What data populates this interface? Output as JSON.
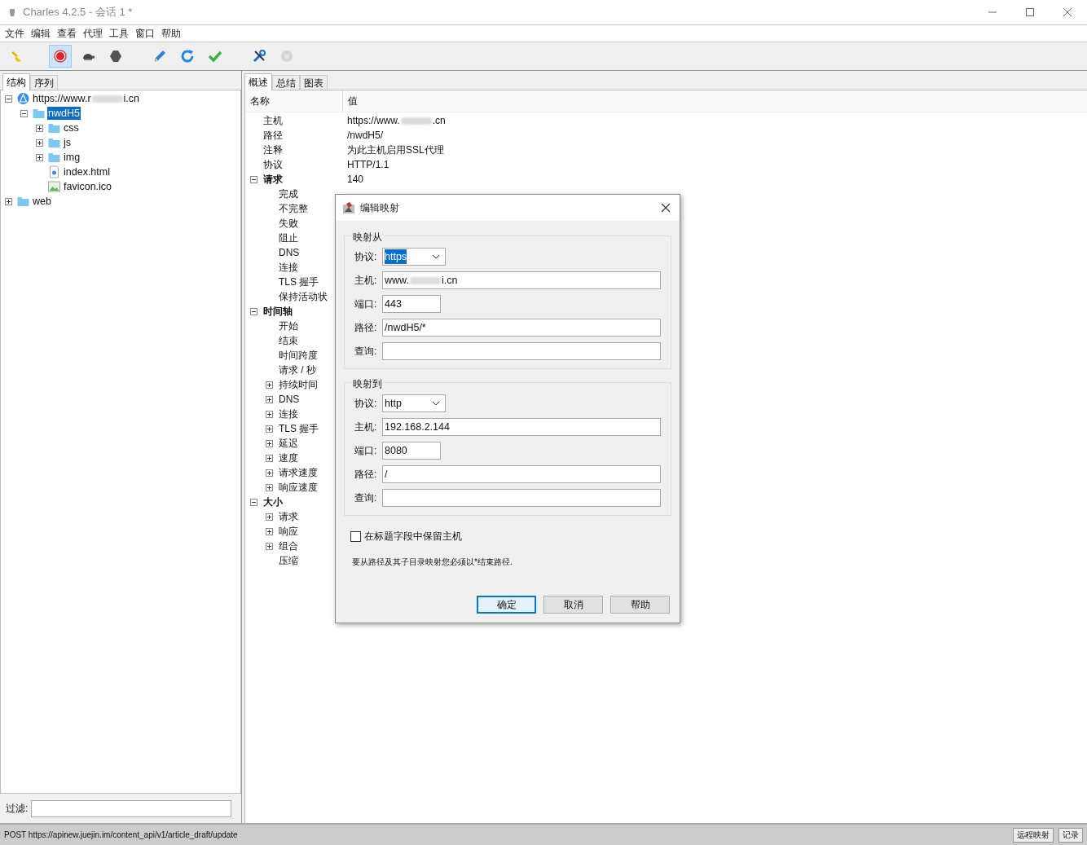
{
  "window": {
    "title": "Charles 4.2.5 - 会话 1 *"
  },
  "menu": [
    "文件",
    "编辑",
    "查看",
    "代理",
    "工具",
    "窗口",
    "帮助"
  ],
  "toolbar": [
    {
      "kind": "broom",
      "pressed": false,
      "disabled": false
    },
    {
      "kind": "record",
      "pressed": true,
      "disabled": false
    },
    {
      "kind": "turtle",
      "pressed": false,
      "disabled": false
    },
    {
      "kind": "stop",
      "pressed": false,
      "disabled": false
    },
    {
      "kind": "pen",
      "pressed": false,
      "disabled": false
    },
    {
      "kind": "refresh",
      "pressed": false,
      "disabled": false
    },
    {
      "kind": "check",
      "pressed": false,
      "disabled": false
    },
    {
      "kind": "tools",
      "pressed": false,
      "disabled": false
    },
    {
      "kind": "gear",
      "pressed": false,
      "disabled": true
    }
  ],
  "left_tabs": [
    {
      "label": "结构",
      "selected": true
    },
    {
      "label": "序列",
      "selected": false
    }
  ],
  "tree": [
    {
      "kind": "globe",
      "parts": [
        "https://www.r",
        "i.cn"
      ],
      "expanded": true,
      "selected": false,
      "children": [
        {
          "kind": "folder",
          "parts": [
            "nwdH5"
          ],
          "expanded": true,
          "selected": true,
          "children": [
            {
              "kind": "folder",
              "parts": [
                "css"
              ],
              "expanded": false,
              "selected": false
            },
            {
              "kind": "folder",
              "parts": [
                "js"
              ],
              "expanded": false,
              "selected": false
            },
            {
              "kind": "folder",
              "parts": [
                "img"
              ],
              "expanded": false,
              "selected": false
            },
            {
              "kind": "html",
              "parts": [
                "index.html"
              ],
              "selected": false
            },
            {
              "kind": "image",
              "parts": [
                "favicon.ico"
              ],
              "selected": false
            }
          ]
        }
      ]
    },
    {
      "kind": "folder",
      "parts": [
        "web"
      ],
      "expanded": false,
      "selected": false
    }
  ],
  "filter": {
    "label": "过滤:"
  },
  "right_tabs": [
    {
      "label": "概述",
      "selected": true
    },
    {
      "label": "总结",
      "selected": false
    },
    {
      "label": "图表",
      "selected": false
    }
  ],
  "table": {
    "columns": [
      "名称",
      "值"
    ],
    "rows": [
      {
        "name": "主机",
        "parts": [
          "https://www.",
          ".cn"
        ]
      },
      {
        "name": "路径",
        "parts": [
          "/nwdH5/"
        ]
      },
      {
        "name": "注释",
        "parts": [
          "为此主机启用SSL代理"
        ]
      },
      {
        "name": "协议",
        "parts": [
          "HTTP/1.1"
        ]
      },
      {
        "name": "请求",
        "parts": [
          "140"
        ],
        "expanded": true,
        "children": [
          {
            "name": "完成"
          },
          {
            "name": "不完整"
          },
          {
            "name": "失败"
          },
          {
            "name": "阻止"
          },
          {
            "name": "DNS"
          },
          {
            "name": "连接"
          },
          {
            "name": "TLS 握手"
          },
          {
            "name": "保持活动状"
          }
        ]
      },
      {
        "name": "时间轴",
        "expanded": true,
        "children": [
          {
            "name": "开始"
          },
          {
            "name": "结束"
          },
          {
            "name": "时间跨度"
          },
          {
            "name": "请求 / 秒"
          },
          {
            "name": "持续时间",
            "expanded": false
          },
          {
            "name": "DNS",
            "expanded": false
          },
          {
            "name": "连接",
            "expanded": false
          },
          {
            "name": "TLS 握手",
            "expanded": false
          },
          {
            "name": "延迟",
            "expanded": false
          },
          {
            "name": "速度",
            "expanded": false
          },
          {
            "name": "请求速度",
            "expanded": false
          },
          {
            "name": "响应速度",
            "expanded": false
          }
        ]
      },
      {
        "name": "大小",
        "expanded": true,
        "children": [
          {
            "name": "请求",
            "expanded": false
          },
          {
            "name": "响应",
            "expanded": false
          },
          {
            "name": "组合",
            "expanded": false
          },
          {
            "name": "压缩"
          }
        ]
      }
    ]
  },
  "dialog": {
    "title": "编辑映射",
    "groups": [
      {
        "title": "映射从",
        "fields": [
          {
            "label": "协议:",
            "kind": "select",
            "parts": [
              "https"
            ],
            "highlighted": true
          },
          {
            "label": "主机:",
            "kind": "text",
            "parts": [
              "www.",
              "i.cn"
            ]
          },
          {
            "label": "端口:",
            "kind": "short",
            "parts": [
              "443"
            ]
          },
          {
            "label": "路径:",
            "kind": "text",
            "parts": [
              "/nwdH5/*"
            ]
          },
          {
            "label": "查询:",
            "kind": "text"
          }
        ]
      },
      {
        "title": "映射到",
        "fields": [
          {
            "label": "协议:",
            "kind": "select",
            "parts": [
              "http"
            ],
            "highlighted": false
          },
          {
            "label": "主机:",
            "kind": "text",
            "parts": [
              "192.168.2.144"
            ]
          },
          {
            "label": "端口:",
            "kind": "short",
            "parts": [
              "8080"
            ]
          },
          {
            "label": "路径:",
            "kind": "text",
            "parts": [
              "/"
            ]
          },
          {
            "label": "查询:",
            "kind": "text"
          }
        ]
      }
    ],
    "checkbox": {
      "label": "在标题字段中保留主机",
      "checked": false
    },
    "note": "要从路径及其子目录映射您必须以*结束路径.",
    "buttons": [
      {
        "label": "确定",
        "default": true
      },
      {
        "label": "取消",
        "default": false
      },
      {
        "label": "帮助",
        "default": false
      }
    ]
  },
  "status_bar": {
    "text": "POST https://apinew.juejin.im/content_api/v1/article_draft/update",
    "buttons": [
      "远程映射",
      "记录"
    ]
  }
}
